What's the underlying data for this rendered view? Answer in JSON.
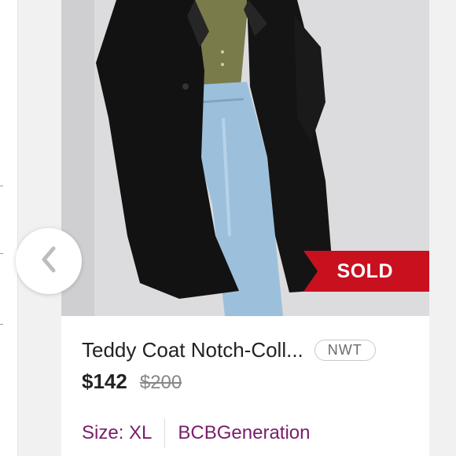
{
  "listing": {
    "title": "Teddy Coat Notch-Coll...",
    "condition_badge": "NWT",
    "price": "$142",
    "original_price": "$200",
    "size": "Size: XL",
    "brand": "BCBGeneration",
    "status_label": "SOLD"
  },
  "icons": {
    "prev": "chevron-left-icon"
  },
  "colors": {
    "sold_banner": "#c8101e",
    "meta_text": "#7a1d6b",
    "coat": "#121212",
    "top": "#7a7b4a",
    "jeans": "#9cc0dc"
  }
}
